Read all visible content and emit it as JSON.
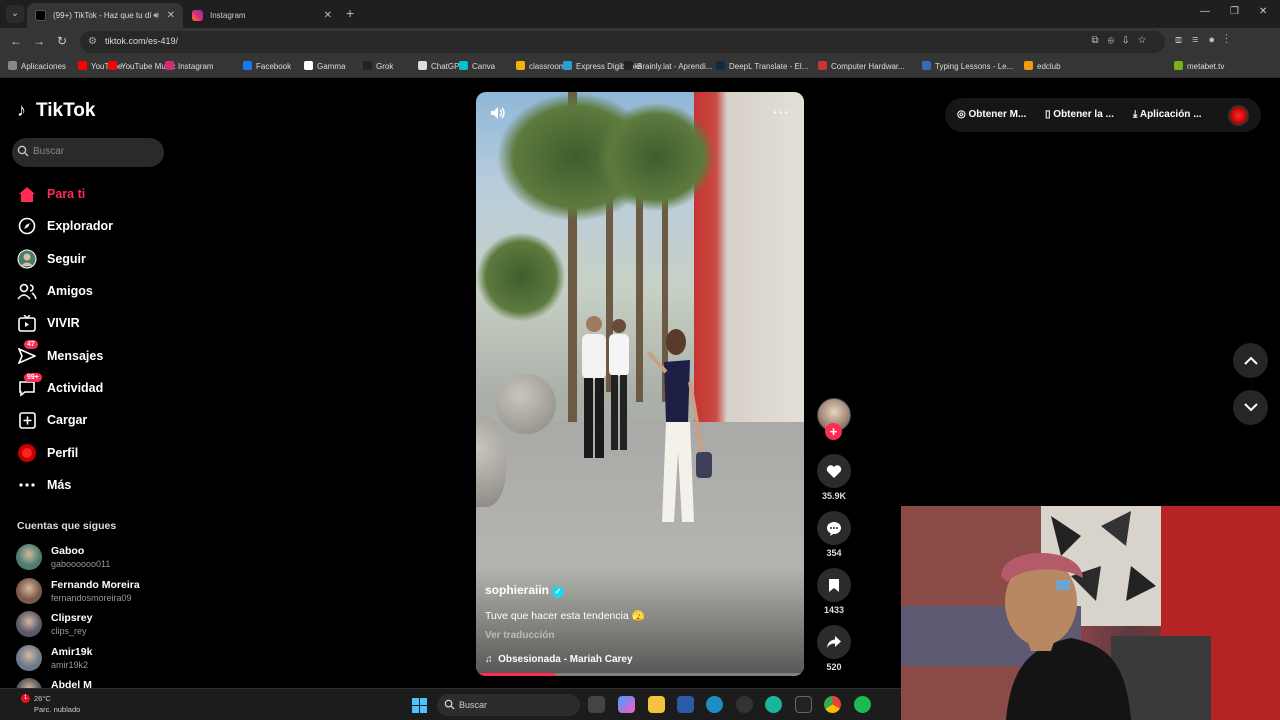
{
  "browser": {
    "tabs": [
      {
        "title": "(99+) TikTok - Haz que tu dí",
        "active": true
      },
      {
        "title": "Instagram",
        "active": false
      }
    ],
    "url": "tiktok.com/es-419/",
    "bookmarks": [
      {
        "label": "Aplicaciones",
        "color": "#888888"
      },
      {
        "label": "YouTube",
        "color": "#ff0000"
      },
      {
        "label": "YouTube Music",
        "color": "#ff0000"
      },
      {
        "label": "Instagram",
        "color": "#d62976"
      },
      {
        "label": "Facebook",
        "color": "#1877f2"
      },
      {
        "label": "Gamma",
        "color": "#ffffff"
      },
      {
        "label": "Grok",
        "color": "#222222"
      },
      {
        "label": "ChatGPT",
        "color": "#dddddd"
      },
      {
        "label": "Canva",
        "color": "#00c4cc"
      },
      {
        "label": "classroom",
        "color": "#f4b400"
      },
      {
        "label": "Express Digibooks",
        "color": "#2a9fd6"
      },
      {
        "label": "Brainly.lat - Aprendi...",
        "color": "#222222"
      },
      {
        "label": "DeepL Translate - El...",
        "color": "#0f2b46"
      },
      {
        "label": "Computer Hardwar...",
        "color": "#cc3333"
      },
      {
        "label": "Typing Lessons - Le...",
        "color": "#2f6eb5"
      },
      {
        "label": "edclub",
        "color": "#f39c12"
      },
      {
        "label": "metabet.tv",
        "color": "#7ab317"
      }
    ]
  },
  "tiktok": {
    "logo": "TikTok",
    "search_placeholder": "Buscar",
    "nav": [
      {
        "label": "Para ti",
        "icon": "home-icon",
        "active": true,
        "badge": ""
      },
      {
        "label": "Explorador",
        "icon": "compass-icon",
        "active": false,
        "badge": ""
      },
      {
        "label": "Seguir",
        "icon": "following-avatar-icon",
        "active": false,
        "badge": ""
      },
      {
        "label": "Amigos",
        "icon": "friends-icon",
        "active": false,
        "badge": ""
      },
      {
        "label": "VIVIR",
        "icon": "live-icon",
        "active": false,
        "badge": ""
      },
      {
        "label": "Mensajes",
        "icon": "messages-icon",
        "active": false,
        "badge": "47"
      },
      {
        "label": "Actividad",
        "icon": "activity-icon",
        "active": false,
        "badge": "99+"
      },
      {
        "label": "Cargar",
        "icon": "upload-icon",
        "active": false,
        "badge": ""
      },
      {
        "label": "Perfil",
        "icon": "profile-icon",
        "active": false,
        "badge": ""
      },
      {
        "label": "Más",
        "icon": "more-icon",
        "active": false,
        "badge": ""
      }
    ],
    "following_title": "Cuentas que sigues",
    "following": [
      {
        "name": "Gaboo",
        "handle": "gaboooooo011"
      },
      {
        "name": "Fernando Moreira",
        "handle": "fernandosmoreira09"
      },
      {
        "name": "Clipsrey",
        "handle": "clips_rey"
      },
      {
        "name": "Amir19k",
        "handle": "amir19k2"
      },
      {
        "name": "Abdel M",
        "handle": ""
      }
    ],
    "video": {
      "author": "sophieraiin",
      "caption": "Tuve que hacer esta tendencia 🫣",
      "translate": "Ver traducción",
      "music": "Obsesionada - Mariah Carey",
      "progress": 0.24
    },
    "actions": {
      "likes": "35.9K",
      "comments": "354",
      "saves": "1433",
      "shares": "520"
    },
    "top_right": {
      "item1": "Obtener M...",
      "item2": "Obtener la ...",
      "item3": "Aplicación ..."
    }
  },
  "taskbar": {
    "weather_temp": "26°C",
    "weather_desc": "Parc. nublado",
    "weather_badge": "1",
    "search_placeholder": "Buscar"
  }
}
